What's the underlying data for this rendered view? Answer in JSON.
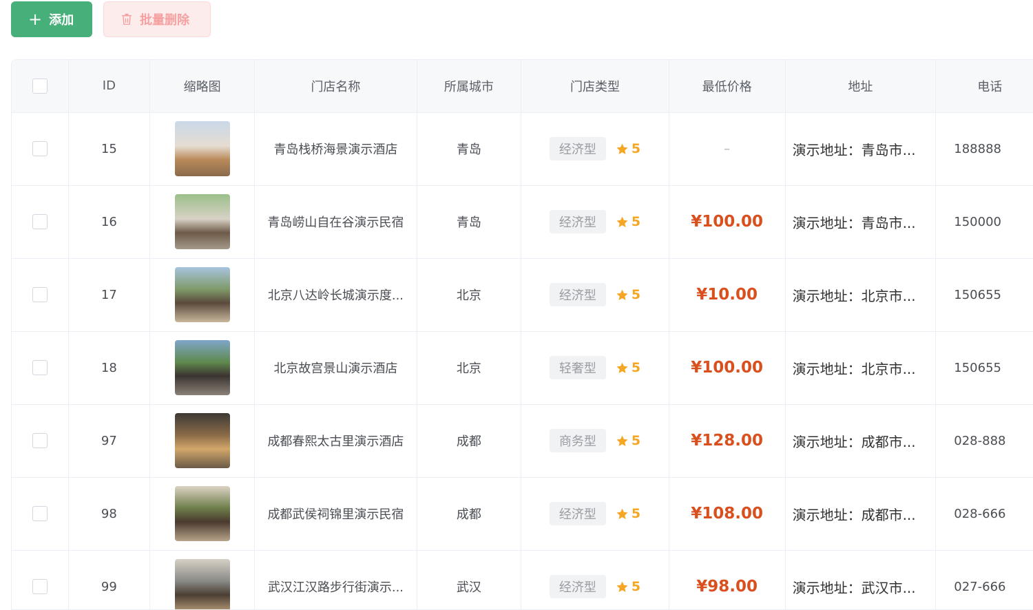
{
  "toolbar": {
    "add_label": "添加",
    "batch_delete_label": "批量删除"
  },
  "colors": {
    "primary": "#47b07a",
    "danger_light": "#fdecec",
    "price": "#d9501e",
    "star": "#f5a623"
  },
  "table": {
    "columns": [
      "ID",
      "缩略图",
      "门店名称",
      "所属城市",
      "门店类型",
      "最低价格",
      "地址",
      "电话"
    ],
    "rows": [
      {
        "id": "15",
        "name": "青岛栈桥海景演示酒店",
        "city": "青岛",
        "type": "经济型",
        "rating": "5",
        "price": "–",
        "address": "演示地址：青岛市...",
        "phone": "188888",
        "thumb_icon": "hotel-photo-icon"
      },
      {
        "id": "16",
        "name": "青岛崂山自在谷演示民宿",
        "city": "青岛",
        "type": "经济型",
        "rating": "5",
        "price": "¥100.00",
        "address": "演示地址：青岛市...",
        "phone": "150000",
        "thumb_icon": "hotel-photo-icon"
      },
      {
        "id": "17",
        "name": "北京八达岭长城演示度...",
        "city": "北京",
        "type": "经济型",
        "rating": "5",
        "price": "¥10.00",
        "address": "演示地址：北京市...",
        "phone": "150655",
        "thumb_icon": "hotel-photo-icon"
      },
      {
        "id": "18",
        "name": "北京故宫景山演示酒店",
        "city": "北京",
        "type": "轻奢型",
        "rating": "5",
        "price": "¥100.00",
        "address": "演示地址：北京市...",
        "phone": "150655",
        "thumb_icon": "hotel-photo-icon"
      },
      {
        "id": "97",
        "name": "成都春熙太古里演示酒店",
        "city": "成都",
        "type": "商务型",
        "rating": "5",
        "price": "¥128.00",
        "address": "演示地址：成都市...",
        "phone": "028-888",
        "thumb_icon": "hotel-photo-icon"
      },
      {
        "id": "98",
        "name": "成都武侯祠锦里演示民宿",
        "city": "成都",
        "type": "经济型",
        "rating": "5",
        "price": "¥108.00",
        "address": "演示地址：成都市...",
        "phone": "028-666",
        "thumb_icon": "hotel-photo-icon"
      },
      {
        "id": "99",
        "name": "武汉江汉路步行街演示...",
        "city": "武汉",
        "type": "经济型",
        "rating": "5",
        "price": "¥98.00",
        "address": "演示地址：武汉市...",
        "phone": "027-666",
        "thumb_icon": "hotel-photo-icon"
      }
    ]
  }
}
